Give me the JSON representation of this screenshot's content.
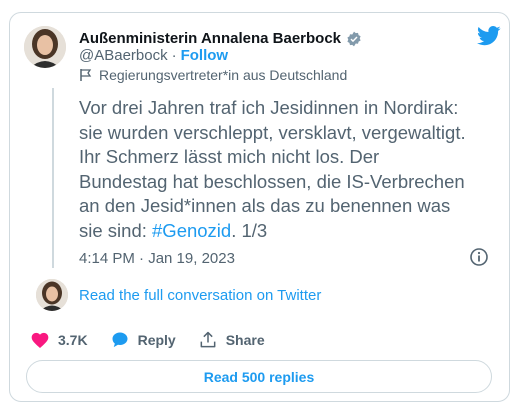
{
  "author": {
    "name": "Außenministerin Annalena Baerbock",
    "handle": "@ABaerbock",
    "separator": "·",
    "follow_label": "Follow",
    "label": "Regierungsvertreter*in aus Deutschland"
  },
  "tweet": {
    "text": "Vor drei Jahren traf ich Jesidinnen in Nordirak:\nsie wurden verschleppt, versklavt, vergewaltigt.\nIhr Schmerz lässt mich nicht los. Der\nBundestag hat beschlossen, die IS-Verbrechen\nan den Jesid*innen als das zu benennen was\nsie sind: ",
    "hashtag": "#Genozid",
    "suffix": ". 1/3",
    "timestamp": "4:14 PM · Jan 19, 2023"
  },
  "read_conversation": "Read the full conversation on Twitter",
  "actions": {
    "likes": "3.7K",
    "reply": "Reply",
    "share": "Share"
  },
  "read_replies": "Read 500 replies",
  "colors": {
    "accent": "#1d9bf0",
    "like": "#f91880",
    "muted": "#536471"
  },
  "icons": [
    "verified-badge-icon",
    "twitter-bird-icon",
    "flag-icon",
    "info-icon",
    "heart-icon",
    "reply-bubble-icon",
    "share-icon"
  ]
}
